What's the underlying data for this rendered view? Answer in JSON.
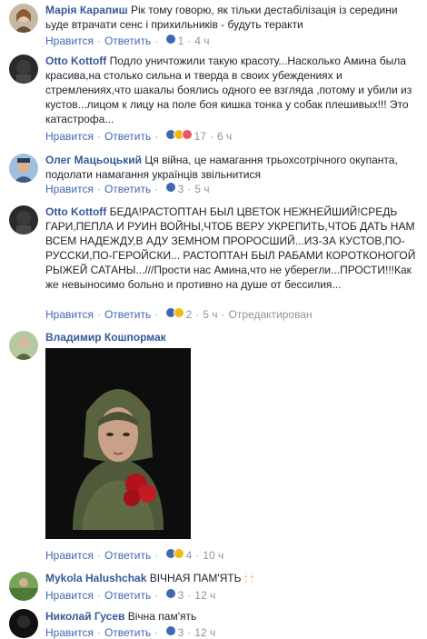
{
  "labels": {
    "like": "Нравится",
    "reply": "Ответить",
    "edited": "Отредактирован"
  },
  "comments": [
    {
      "author": "Марія Карапиш",
      "text": "Рік тому говорю, як тільки дестабілізація із середини ьуде втрачати сенс і прихильників - будуть теракти",
      "reactions": "1",
      "time": "4 ч"
    },
    {
      "author": "Otto Kottoff",
      "text": "Подло уничтожили такую красоту...Насколько Амина была красива,на столько сильна и тверда в своих убеждениях и стремлениях,что шакалы боялись одного ее взгляда ,потому и убили из кустов...лицом к лицу на поле боя кишка тонка у собак плешивых!!! Это катастрофа...",
      "reactions": "17",
      "time": "6 ч"
    },
    {
      "author": "Олег Мацьоцький",
      "text": "Ця війна, це намагання трьохсотрічного окупанта, подолати намагання українців звільнитися",
      "reactions": "3",
      "time": "5 ч"
    },
    {
      "author": "Otto Kottoff",
      "text": "БЕДА!РАСТОПТАН БЫЛ ЦВЕТОК НЕЖНЕЙШИЙ!СРЕДЬ ГАРИ,ПЕПЛА И РУИН ВОЙНЫ,ЧТОБ ВЕРУ УКРЕПИТЬ,ЧТОБ ДАТЬ НАМ ВСЕМ НАДЕЖДУ,В АДУ ЗЕМНОМ ПРОРОСШИЙ...ИЗ-ЗА КУСТОВ,ПО-РУССКИ,ПО-ГЕРОЙСКИ... РАСТОПТАН БЫЛ РАБАМИ КОРОТКОНОГОЙ РЫЖЕЙ САТАНЫ...///Прости нас Амина,что не уберегли...ПРОСТИ!!!Как же невыносимо больно и противно на душе от бессилия...",
      "reactions": "2",
      "time": "5 ч"
    },
    {
      "author": "Владимир Кошпормак",
      "text": "",
      "reactions": "4",
      "time": "10 ч"
    },
    {
      "author": "Mykola Halushchak",
      "text": "ВІЧНАЯ ПАМ'ЯТЬ",
      "reactions": "3",
      "time": "12 ч"
    },
    {
      "author": "Николай Гусев",
      "text": "Вічна пам'ять",
      "reactions": "3",
      "time": "12 ч"
    }
  ]
}
